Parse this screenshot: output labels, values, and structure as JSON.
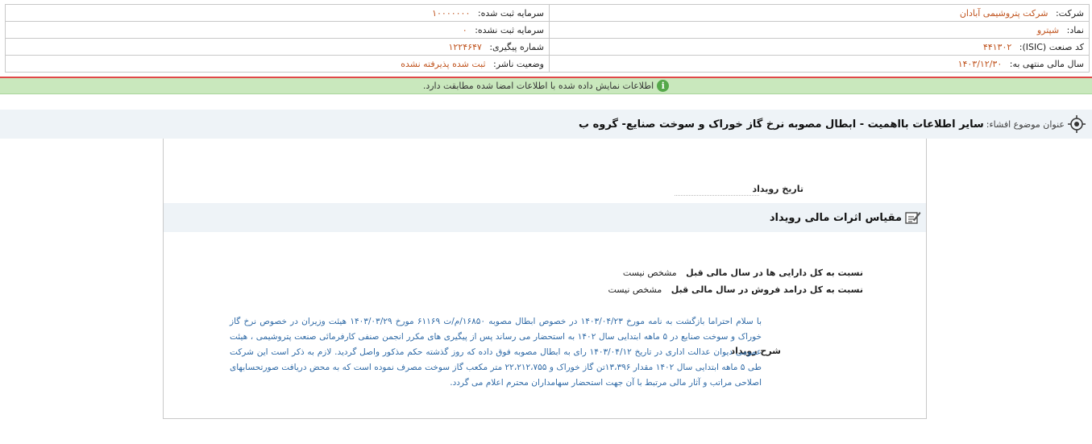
{
  "company_info": {
    "company_label": "شرکت:",
    "company_value": "شرکت پتروشیمی آبادان",
    "registered_capital_label": "سرمایه ثبت شده:",
    "registered_capital_value": "۱۰۰۰۰۰۰۰",
    "symbol_label": "نماد:",
    "symbol_value": "شپترو",
    "unregistered_capital_label": "سرمایه ثبت نشده:",
    "unregistered_capital_value": "۰",
    "isic_label": "کد صنعت (ISIC):",
    "isic_value": "۴۴۱۳۰۲",
    "tracking_label": "شماره پیگیری:",
    "tracking_value": "۱۲۲۴۶۴۷",
    "fiscal_year_label": "سال مالی منتهی به:",
    "fiscal_year_value": "۱۴۰۳/۱۲/۳۰",
    "publisher_status_label": "وضعیت ناشر:",
    "publisher_status_value": "ثبت شده پذیرفته نشده"
  },
  "notice": {
    "message": "اطلاعات نمایش داده شده با اطلاعات امضا شده مطابقت دارد.",
    "icon": "info-icon"
  },
  "disclosure": {
    "subject_label": "عنوان موضوع افشاء:",
    "subject_title": "سایر اطلاعات بااهمیت - ابطال مصوبه نرخ گاز خوراک و سوخت صنایع- گروه ب"
  },
  "event": {
    "date_label": "تاریخ رویداد",
    "date_value": ""
  },
  "financial_effects": {
    "section_title": "مقیاس اثرات مالی رویداد",
    "ratio_assets_label": "نسبت به کل دارایی ها در سال مالی قبل",
    "ratio_assets_value": "مشخص نیست",
    "ratio_sales_label": "نسبت به کل درامد فروش در سال مالی قبل",
    "ratio_sales_value": "مشخص نیست"
  },
  "description": {
    "label": "شرح رویداد",
    "text": "با سلام احتراما بازگشت به نامه مورخ ۱۴۰۳/۰۴/۲۳ در خصوص ابطال مصوبه ۱۶۸۵۰/م/ت ۶۱۱۶۹ مورخ ۱۴۰۳/۰۳/۲۹ هیئت وزیران در خصوص نرخ گاز خوراک و سوخت صنایع در ۵ ماهه ابتدایی سال ۱۴۰۲ به استحضار می رساند پس از پیگیری های مکرر انجمن صنفی کارفرمائی صنعت پتروشیمی ، هیئت عمومی دیوان عدالت اداری در تاریخ ۱۴۰۳/۰۴/۱۲ رای به ابطال مصوبه فوق داده که روز گذشته حکم مذکور واصل گردید. لازم به ذکر است این شرکت طی ۵ ماهه ابتدایی سال ۱۴۰۲ مقدار ۱۳،۳۹۶تن گاز خوراک و ۲۲،۲۱۲،۷۵۵ متر مکعب گاز سوخت مصرف نموده است که به محض دریافت صورتحسابهای اصلاحی مراتب و آثار مالی مرتبط با آن جهت استحضار سهامداران محترم اعلام می گردد."
  }
}
